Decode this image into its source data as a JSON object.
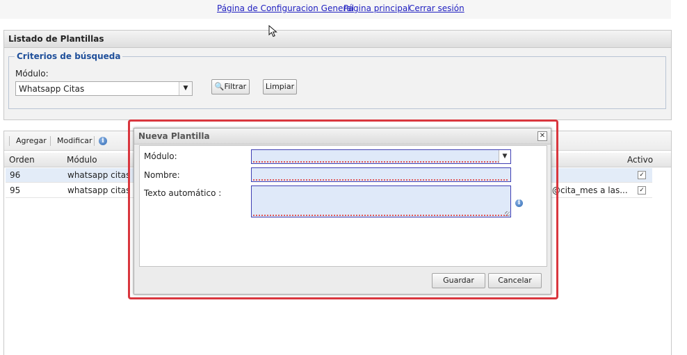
{
  "top_links": [
    "Página de Configuracion General",
    "Página principal",
    "Cerrar sesión"
  ],
  "panel": {
    "title": "Listado de Plantillas",
    "criteria_legend": "Criterios de búsqueda",
    "module_label": "Módulo:",
    "module_value": "Whatsapp Citas",
    "filter_button": "Filtrar",
    "clear_button": "Limpiar"
  },
  "grid": {
    "toolbar": {
      "add": "Agregar",
      "modify": "Modificar"
    },
    "headers": {
      "order": "Orden",
      "module": "Módulo",
      "active": "Activo"
    },
    "rows": [
      {
        "order": "96",
        "module": "whatsapp citas",
        "text_tail": "",
        "active": true
      },
      {
        "order": "95",
        "module": "whatsapp citas",
        "text_tail": "@cita_mes a las...",
        "active": true
      }
    ]
  },
  "dialog": {
    "title": "Nueva Plantilla",
    "module_label": "Módulo:",
    "name_label": "Nombre:",
    "text_label": "Texto automático :",
    "save_button": "Guardar",
    "cancel_button": "Cancelar"
  },
  "colors": {
    "highlight": "#d9363e",
    "link": "#2020c0",
    "legend": "#1f4f9a"
  }
}
